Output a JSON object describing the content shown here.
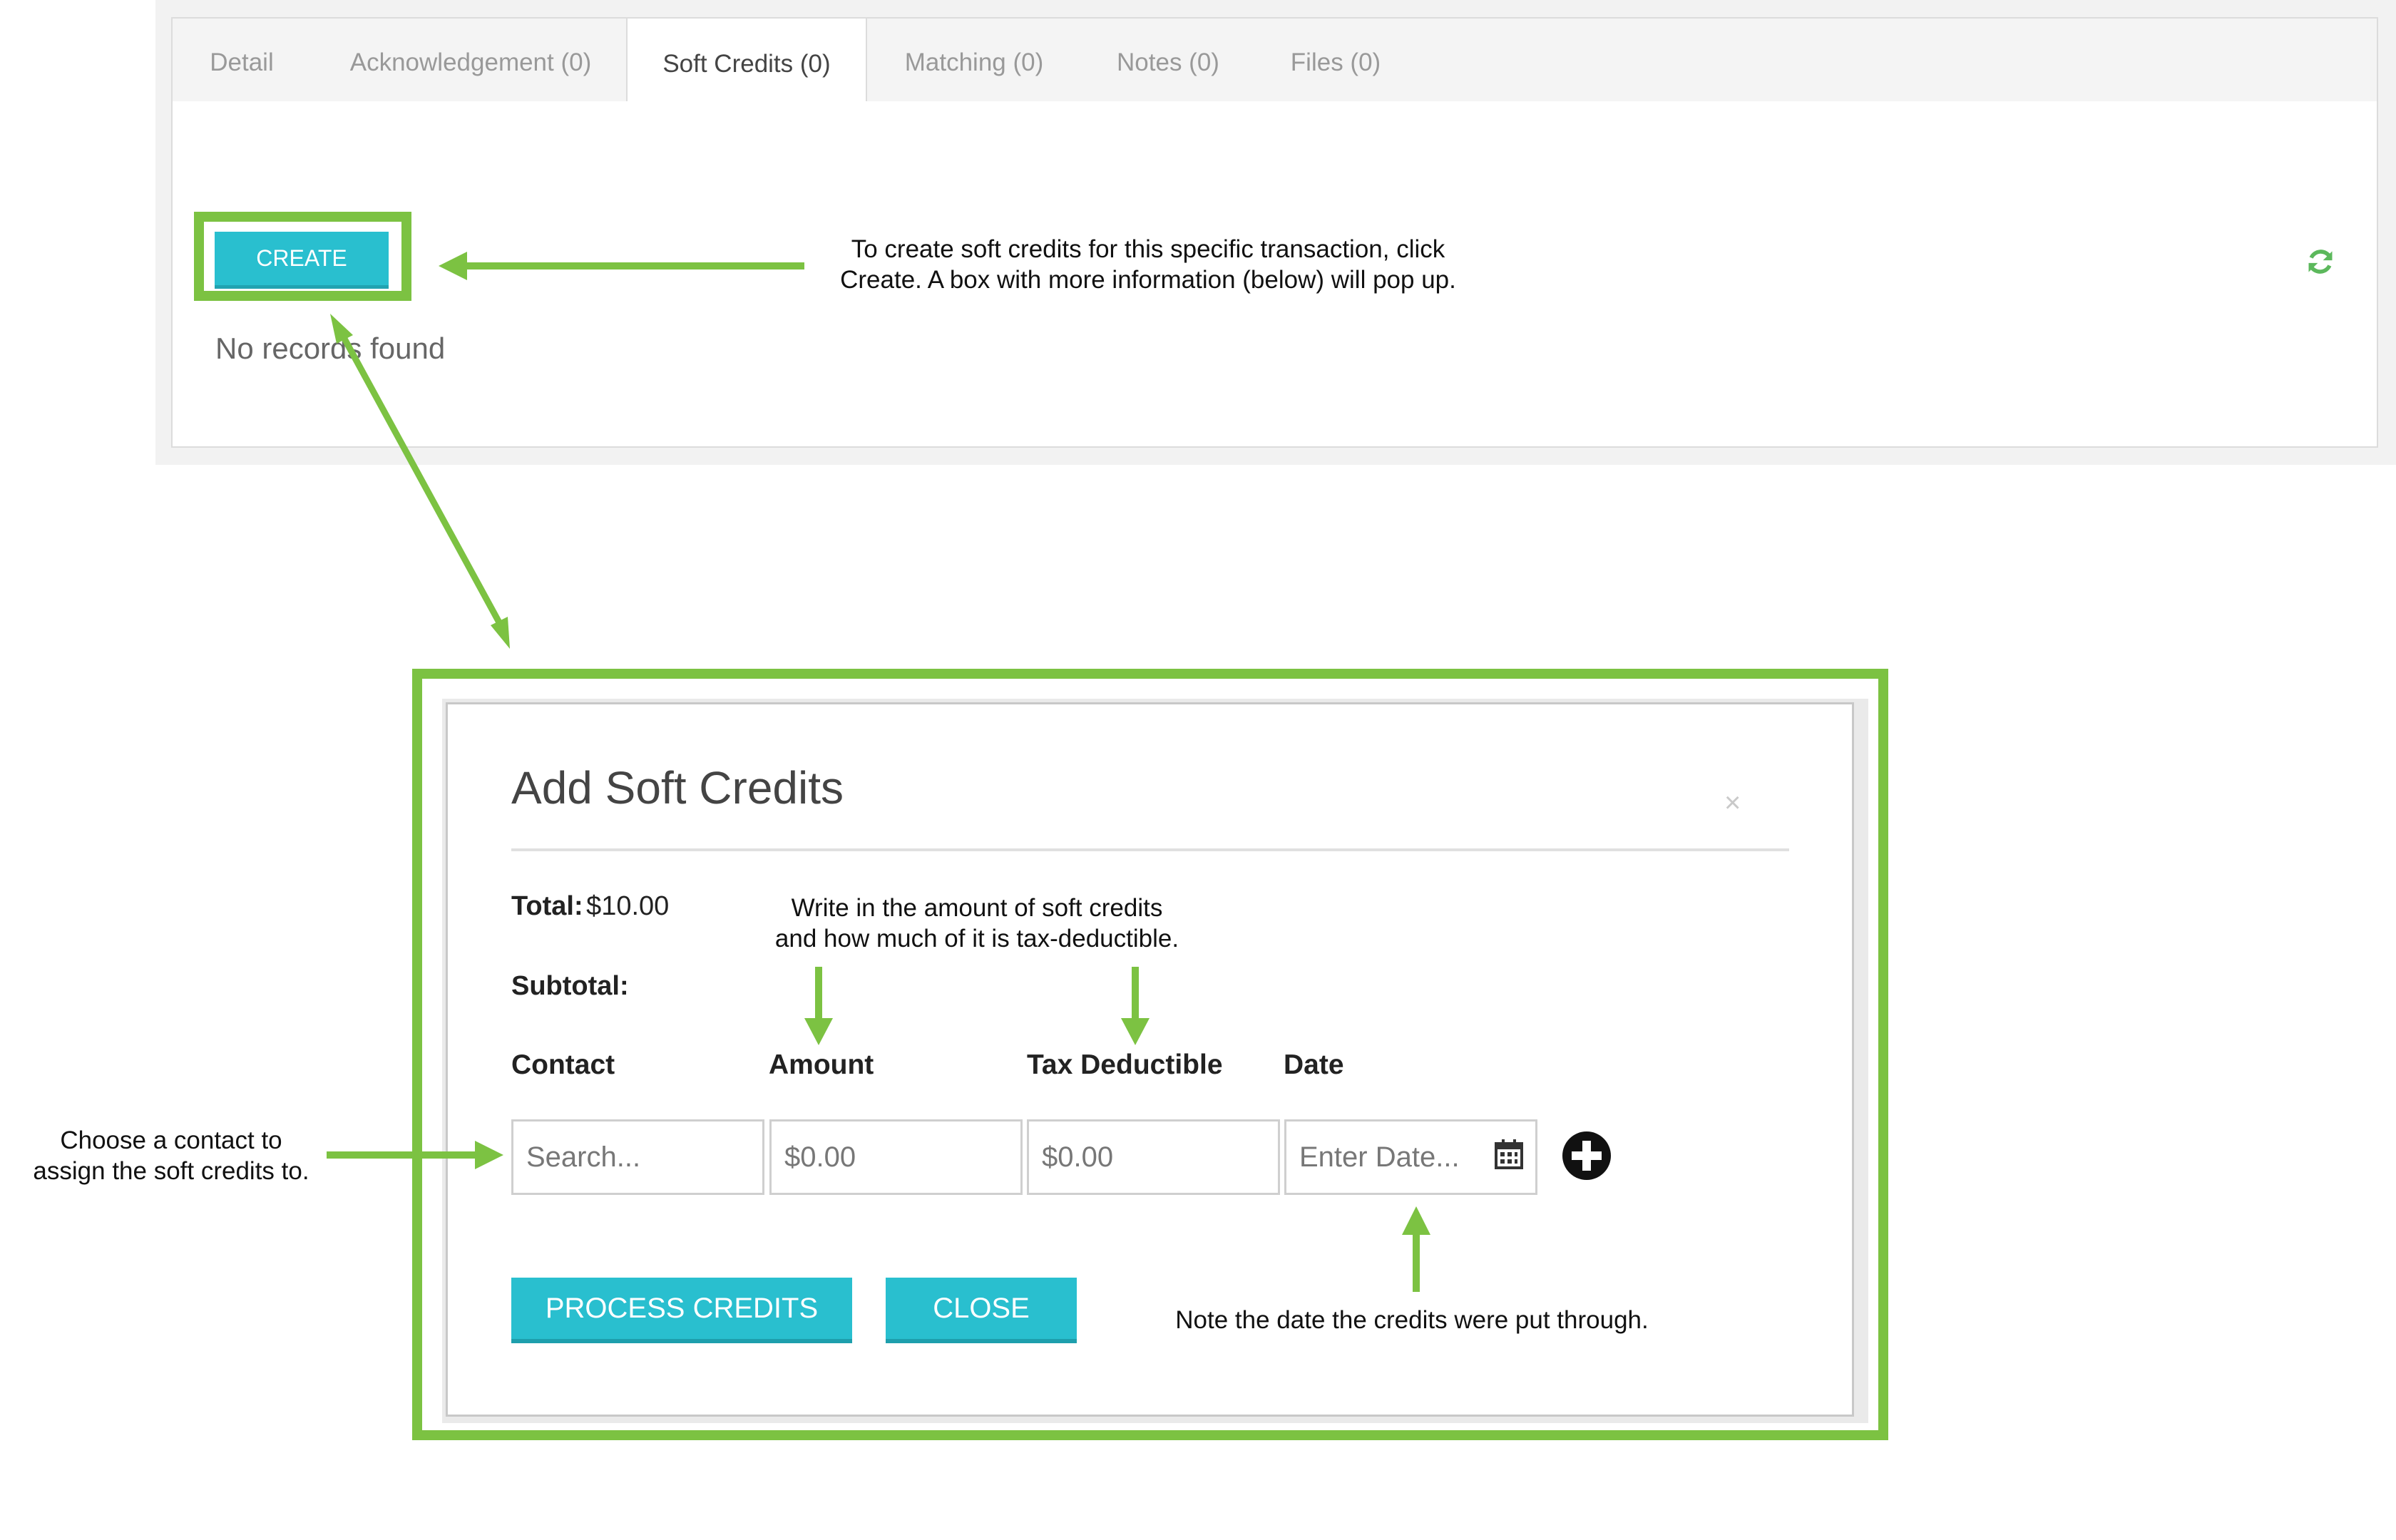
{
  "tabs": [
    {
      "label": "Detail"
    },
    {
      "label": "Acknowledgement (0)"
    },
    {
      "label": "Soft Credits (0)"
    },
    {
      "label": "Matching (0)"
    },
    {
      "label": "Notes (0)"
    },
    {
      "label": "Files (0)"
    }
  ],
  "active_tab": "Soft Credits (0)",
  "panel": {
    "create_label": "CREATE",
    "empty_text": "No records found"
  },
  "annotations": {
    "create_note": [
      "To create soft credits for this specific transaction, click",
      "Create. A box with more information (below) will pop up."
    ],
    "amount_note": [
      "Write in the amount of soft credits",
      "and how much of it is tax-deductible."
    ],
    "contact_note": [
      "Choose a contact to",
      "assign the soft credits to."
    ],
    "date_note": "Note the date the credits were put through."
  },
  "modal": {
    "title": "Add Soft Credits",
    "close_glyph": "×",
    "total_label": "Total:",
    "total_value": "$10.00",
    "subtotal_label": "Subtotal:",
    "columns": {
      "contact": "Contact",
      "amount": "Amount",
      "tax_deductible": "Tax Deductible",
      "date": "Date"
    },
    "fields": {
      "contact_placeholder": "Search...",
      "amount_placeholder": "$0.00",
      "tax_placeholder": "$0.00",
      "date_placeholder": "Enter Date..."
    },
    "process_label": "PROCESS CREDITS",
    "close_label": "CLOSE"
  },
  "colors": {
    "accent_teal": "#29bfcf",
    "highlight_green": "#7cc242"
  },
  "icons": [
    "refresh-icon",
    "calendar-icon",
    "add-circle-icon",
    "close-icon"
  ]
}
